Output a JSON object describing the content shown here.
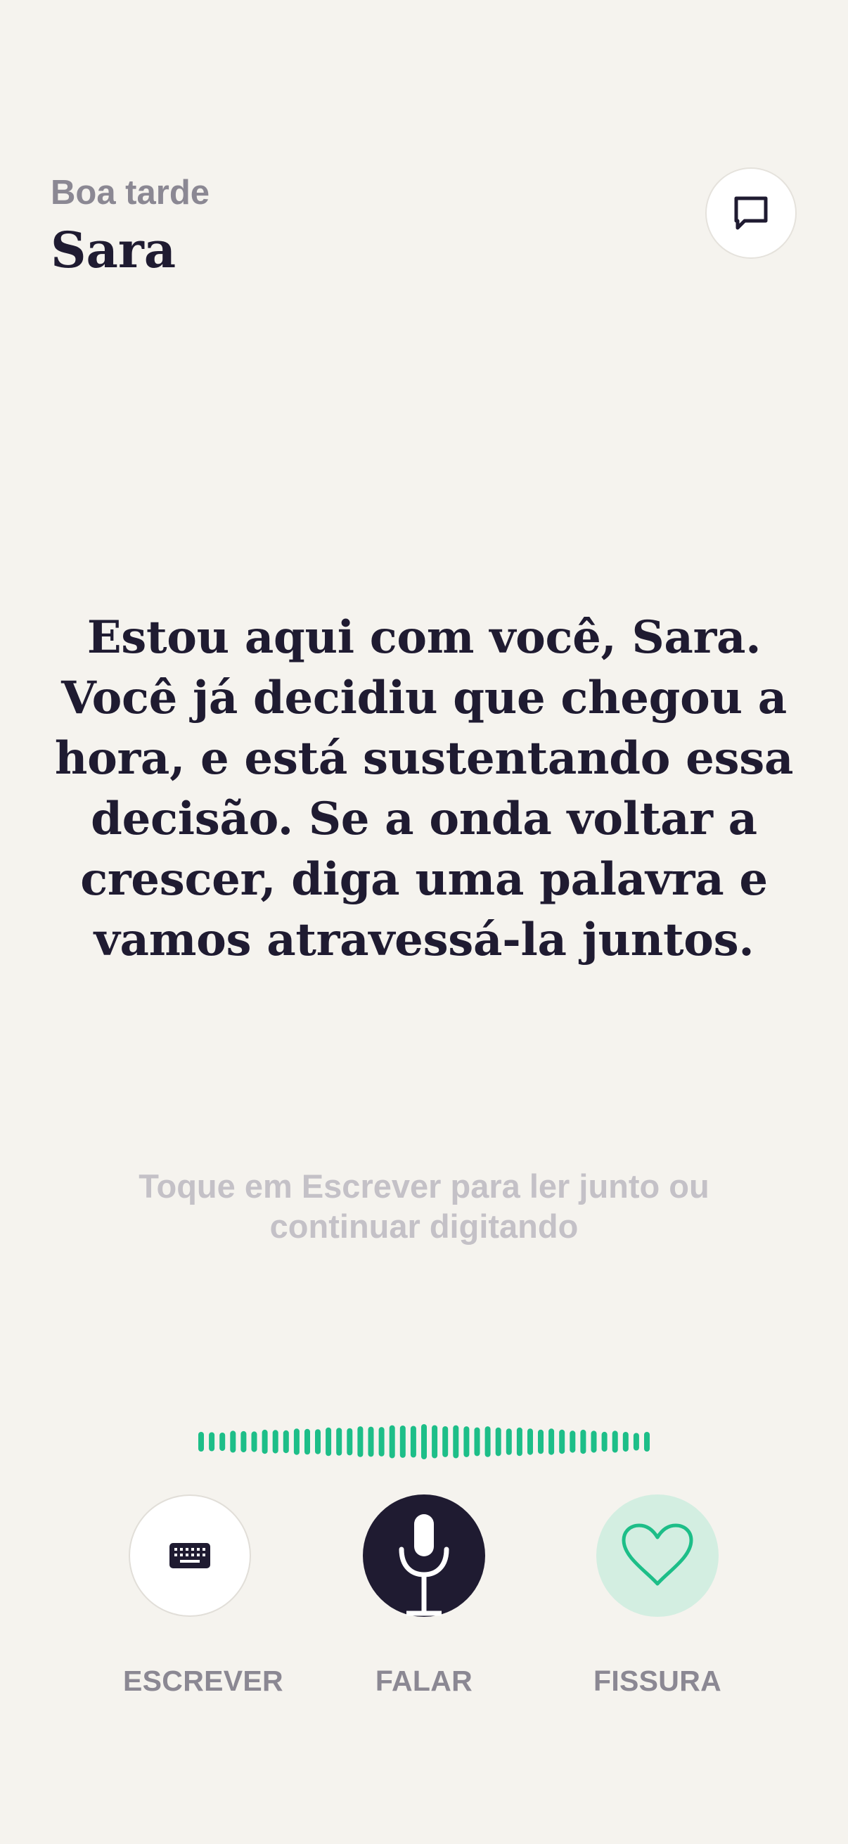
{
  "header": {
    "greeting": "Boa tarde",
    "name": "Sara",
    "chat_icon": "chat-bubble-icon"
  },
  "message": {
    "lines": [
      "Estou aqui com você, Sara.",
      "Você já decidiu que chegou a",
      "hora, e está sustentando essa",
      "decisão. Se a onda voltar a",
      "crescer, diga uma palavra e",
      "vamos atravessá-la juntos."
    ]
  },
  "hint": {
    "line1": "Toque em Escrever para ler junto ou",
    "line2": "continuar digitando"
  },
  "waveform": {
    "color": "#1dbe88",
    "bar_count": 43
  },
  "actions": {
    "write": {
      "label": "ESCREVER",
      "icon": "keyboard-icon"
    },
    "speak": {
      "label": "FALAR",
      "icon": "microphone-icon"
    },
    "craving": {
      "label": "FISSURA",
      "icon": "heart-icon"
    }
  },
  "colors": {
    "background": "#f5f3ee",
    "primary_text": "#1f1b31",
    "secondary_text": "#8b8893",
    "hint_text": "#c4c1c7",
    "accent": "#1dbe88",
    "accent_soft": "#d3eee1"
  }
}
